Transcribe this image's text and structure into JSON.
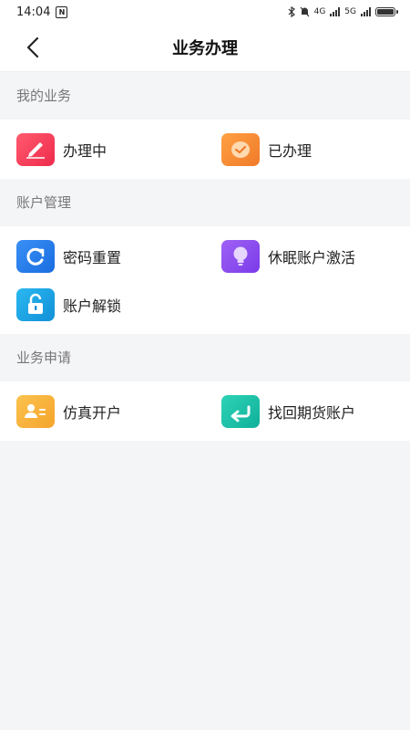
{
  "status_bar": {
    "time": "14:04",
    "network_1": "4G",
    "network_2": "5G"
  },
  "nav": {
    "title": "业务办理"
  },
  "sections": [
    {
      "title": "我的业务",
      "items": [
        {
          "label": "办理中",
          "icon": "pen-icon",
          "color": "#f23c5a"
        },
        {
          "label": "已办理",
          "icon": "check-circle-icon",
          "color": "#f68a35"
        }
      ]
    },
    {
      "title": "账户管理",
      "items": [
        {
          "label": "密码重置",
          "icon": "refresh-icon",
          "color": "#1e7ef0"
        },
        {
          "label": "休眠账户激活",
          "icon": "lightbulb-icon",
          "color": "#8c4df0"
        },
        {
          "label": "账户解锁",
          "icon": "unlock-icon",
          "color": "#1aa4e8"
        }
      ]
    },
    {
      "title": "业务申请",
      "items": [
        {
          "label": "仿真开户",
          "icon": "id-card-icon",
          "color": "#f7b23a"
        },
        {
          "label": "找回期货账户",
          "icon": "return-arrow-icon",
          "color": "#17c0a8"
        }
      ]
    }
  ]
}
